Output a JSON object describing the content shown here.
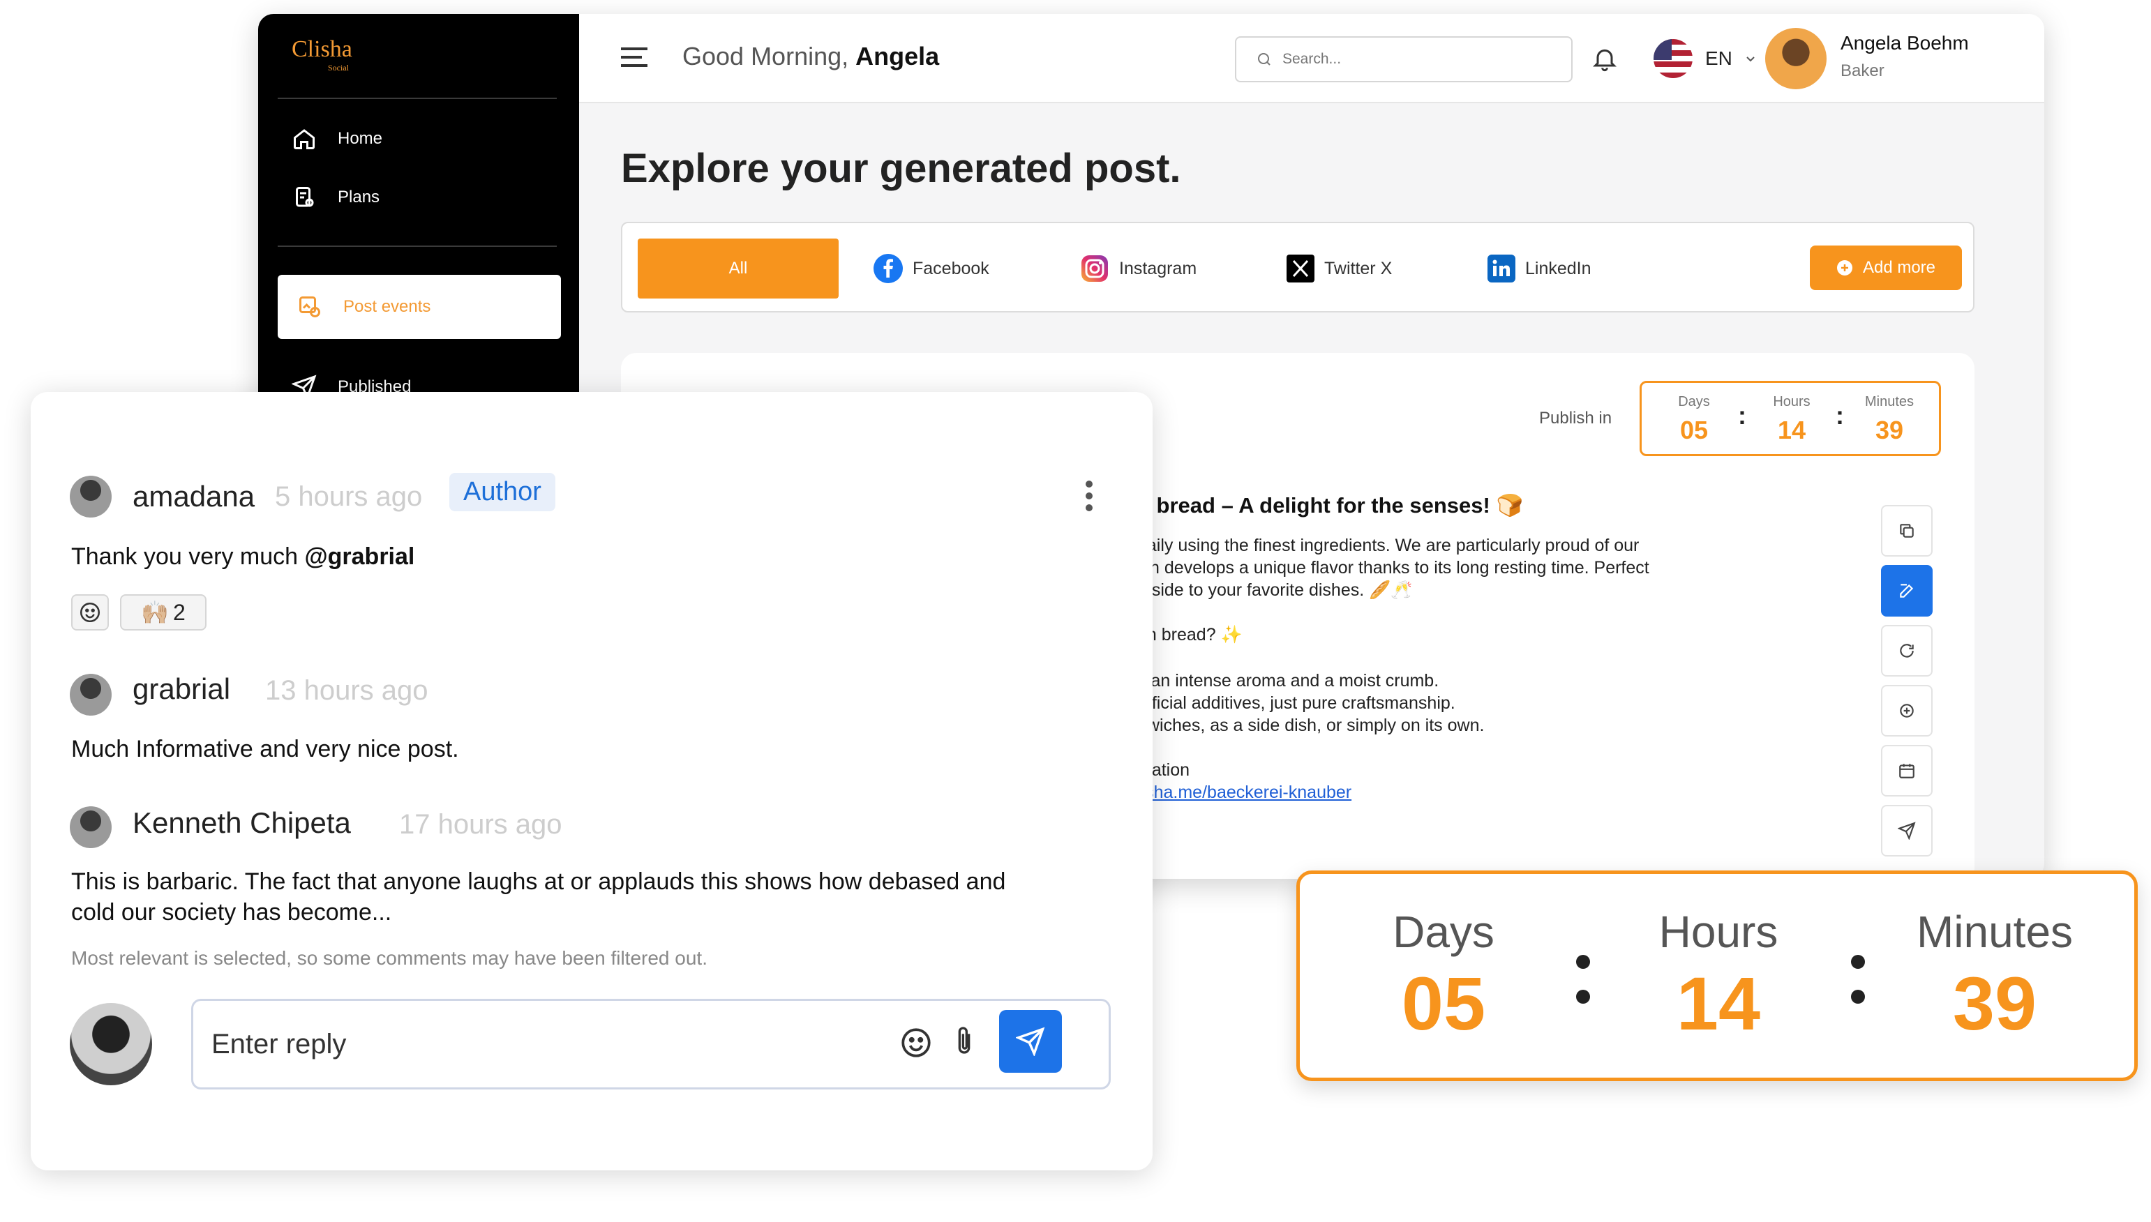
{
  "app": {
    "logo": "Clisha",
    "logo_sub": "Social",
    "sidebar": {
      "items": [
        {
          "label": "Home",
          "icon": "home-icon"
        },
        {
          "label": "Plans",
          "icon": "plans-icon"
        }
      ],
      "active": {
        "label": "Post events",
        "icon": "post-events-icon"
      },
      "partial": {
        "label": "Published",
        "icon": "send-icon"
      }
    },
    "header": {
      "greeting": "Good Morning, ",
      "greeting_name": "Angela",
      "search_placeholder": "Search...",
      "language": "EN",
      "user_name": "Angela Boehm",
      "user_role": "Baker"
    },
    "heading": "Explore your generated post.",
    "tabs": {
      "all": "All",
      "facebook": "Facebook",
      "instagram": "Instagram",
      "twitter": "Twitter X",
      "linkedin": "LinkedIn",
      "add_more": "Add more"
    },
    "post": {
      "publish_label": "Publish in",
      "countdown": {
        "days_label": "Days",
        "days": "05",
        "hours_label": "Hours",
        "hours": "14",
        "minutes_label": "Minutes",
        "minutes": "39"
      },
      "title": "n bread – A delight for the senses! 🍞",
      "lines": [
        "daily using the finest ingredients. We are particularly proud of our",
        "ich develops a unique flavor thanks to its long resting time. Perfect",
        "a side to your favorite dishes. 🥖🥂",
        "gh bread? ✨",
        "s an intense aroma and a moist crumb.",
        "rtificial additives, just pure craftsmanship.",
        "dwiches, as a side dish, or simply on its own.",
        "mation"
      ],
      "link": "lisha.me/baeckerei-knauber"
    }
  },
  "comments": {
    "items": [
      {
        "name": "amadana",
        "time": "5 hours ago",
        "badge": "Author",
        "text_prefix": "Thank you very much ",
        "mention": "@grabrial",
        "reaction_count": "2",
        "reaction_emoji": "🙌🏼"
      },
      {
        "name": "grabrial",
        "time": "13 hours ago",
        "text": "Much Informative and very nice post."
      },
      {
        "name": "Kenneth Chipeta",
        "time": "17 hours ago",
        "text_line1": "This is barbaric. The fact that anyone laughs at or applauds this shows how debased and",
        "text_line2": "cold our society has become..."
      }
    ],
    "note": "Most relevant is selected, so some comments may have been filtered out.",
    "reply_placeholder": "Enter reply"
  },
  "countdown": {
    "days_label": "Days",
    "days": "05",
    "hours_label": "Hours",
    "hours": "14",
    "minutes_label": "Minutes",
    "minutes": "39"
  },
  "colors": {
    "accent": "#f7941d",
    "primary": "#1d73e8",
    "sidebar": "#000000"
  }
}
